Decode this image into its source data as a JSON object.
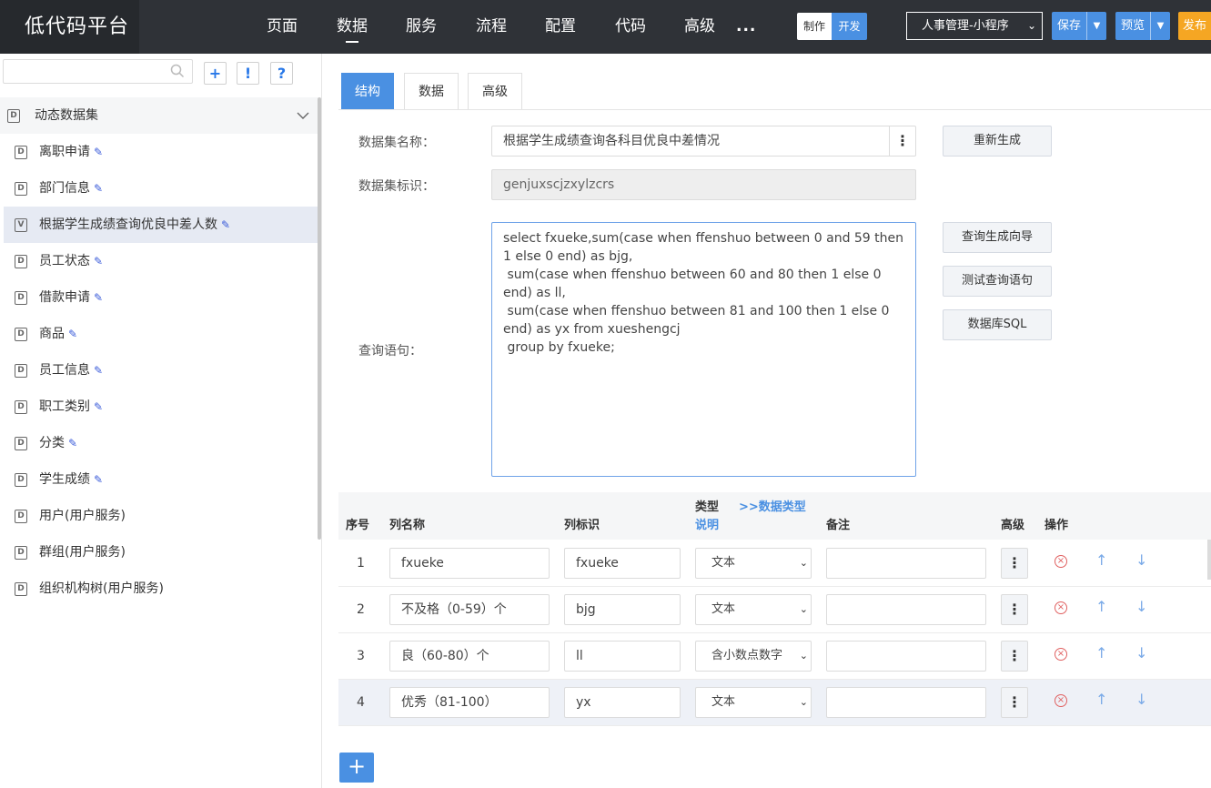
{
  "app": {
    "title": "低代码平台",
    "nav": [
      "页面",
      "数据",
      "服务",
      "流程",
      "配置",
      "代码",
      "高级"
    ],
    "nav_more": "...",
    "mode_make": "制作",
    "mode_dev": "开发",
    "app_select": "人事管理-小程序",
    "save": "保存",
    "preview": "预览",
    "publish": "发布"
  },
  "sidebar": {
    "search_placeholder": "",
    "tool_add": "+",
    "tool_alert": "!",
    "tool_help": "?",
    "group": "动态数据集",
    "items": [
      {
        "label": "离职申请",
        "icon": "D"
      },
      {
        "label": "部门信息",
        "icon": "D"
      },
      {
        "label": "根据学生成绩查询优良中差人数",
        "icon": "V"
      },
      {
        "label": "员工状态",
        "icon": "D"
      },
      {
        "label": "借款申请",
        "icon": "D"
      },
      {
        "label": "商品",
        "icon": "D"
      },
      {
        "label": "员工信息",
        "icon": "D"
      },
      {
        "label": "职工类别",
        "icon": "D"
      },
      {
        "label": "分类",
        "icon": "D"
      },
      {
        "label": "学生成绩",
        "icon": "D"
      },
      {
        "label": "用户(用户服务)",
        "icon": "D"
      },
      {
        "label": "群组(用户服务)",
        "icon": "D"
      },
      {
        "label": "组织机构树(用户服务)",
        "icon": "D"
      }
    ]
  },
  "tabs": [
    "结构",
    "数据",
    "高级"
  ],
  "form": {
    "name_label": "数据集名称：",
    "name_value": "根据学生成绩查询各科目优良中差情况",
    "id_label": "数据集标识：",
    "id_value": "genjuxscjzxylzcrs",
    "query_label": "查询语句：",
    "query_value": "select fxueke,sum(case when ffenshuo between 0 and 59 then 1 else 0 end) as bjg,\n sum(case when ffenshuo between 60 and 80 then 1 else 0 end) as ll,\n sum(case when ffenshuo between 81 and 100 then 1 else 0 end) as yx from xueshengcj\n group by fxueke;",
    "btn_regenerate": "重新生成",
    "btn_wizard": "查询生成向导",
    "btn_test": "测试查询语句",
    "btn_dbsql": "数据库SQL"
  },
  "table": {
    "headers": {
      "no": "序号",
      "name": "列名称",
      "id": "列标识",
      "type": "类型",
      "type_link": ">>数据类型",
      "type_desc": "说明",
      "remark": "备注",
      "adv": "高级",
      "op": "操作"
    },
    "rows": [
      {
        "no": "1",
        "name": "fxueke",
        "id": "fxueke",
        "type": "文本",
        "remark": ""
      },
      {
        "no": "2",
        "name": "不及格（0-59）个",
        "id": "bjg",
        "type": "文本",
        "remark": ""
      },
      {
        "no": "3",
        "name": "良（60-80）个",
        "id": "ll",
        "type": "含小数点数字",
        "remark": ""
      },
      {
        "no": "4",
        "name": "优秀（81-100）",
        "id": "yx",
        "type": "文本",
        "remark": ""
      }
    ],
    "add": "+"
  }
}
